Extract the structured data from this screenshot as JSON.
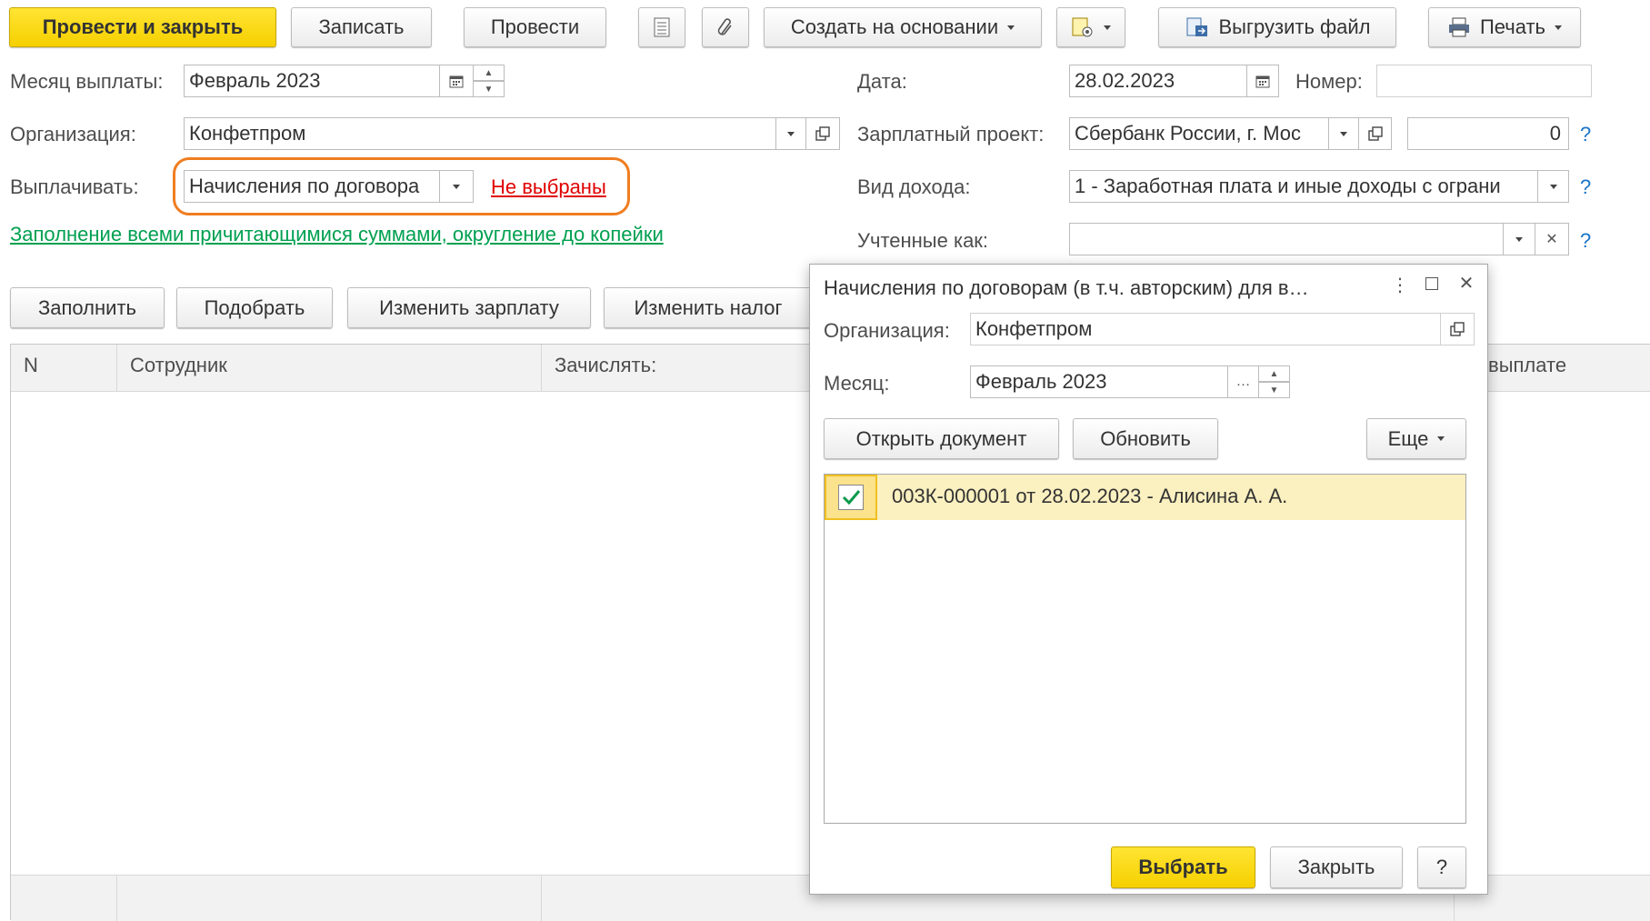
{
  "toolbar": {
    "post_close": "Провести и закрыть",
    "save": "Записать",
    "post": "Провести",
    "create_based": "Создать на основании",
    "export": "Выгрузить файл",
    "print": "Печать"
  },
  "form": {
    "month_label": "Месяц выплаты:",
    "month_value": "Февраль 2023",
    "org_label": "Организация:",
    "org_value": "Конфетпром",
    "pay_label": "Выплачивать:",
    "pay_value": "Начисления по договора",
    "pay_link": "Не выбраны",
    "fill_link": "Заполнение всеми причитающимися суммами, округление до копейки",
    "date_label": "Дата:",
    "date_value": "28.02.2023",
    "number_label": "Номер:",
    "number_value": "",
    "project_label": "Зарплатный проект:",
    "project_value": "Сбербанк России, г. Мос",
    "project_count": "0",
    "income_label": "Вид дохода:",
    "income_value": "1 - Заработная плата и иные доходы с ограни",
    "accounted_label": "Учтенные как:",
    "accounted_value": "",
    "help": "?"
  },
  "table_toolbar": {
    "fill": "Заполнить",
    "pick": "Подобрать",
    "change_salary": "Изменить зарплату",
    "change_tax": "Изменить налог"
  },
  "table": {
    "col_n": "N",
    "col_employee": "Сотрудник",
    "col_credit": "Зачислять:",
    "col_payout": "выплате"
  },
  "dialog": {
    "title": "Начисления по договорам (в т.ч. авторским) для в…",
    "org_label": "Организация:",
    "org_value": "Конфетпром",
    "month_label": "Месяц:",
    "month_value": "Февраль 2023",
    "open_doc": "Открыть документ",
    "refresh": "Обновить",
    "more": "Еще",
    "list": [
      {
        "checked": true,
        "text": "003К-000001 от 28.02.2023 - Алисина А. А."
      }
    ],
    "select": "Выбрать",
    "close": "Закрыть",
    "help": "?"
  },
  "colors": {
    "accent_yellow": "#f5d000",
    "link_red": "#e00000",
    "link_green": "#00a050",
    "highlight_orange": "#f07d20",
    "selected_row": "#fbf0c0"
  }
}
